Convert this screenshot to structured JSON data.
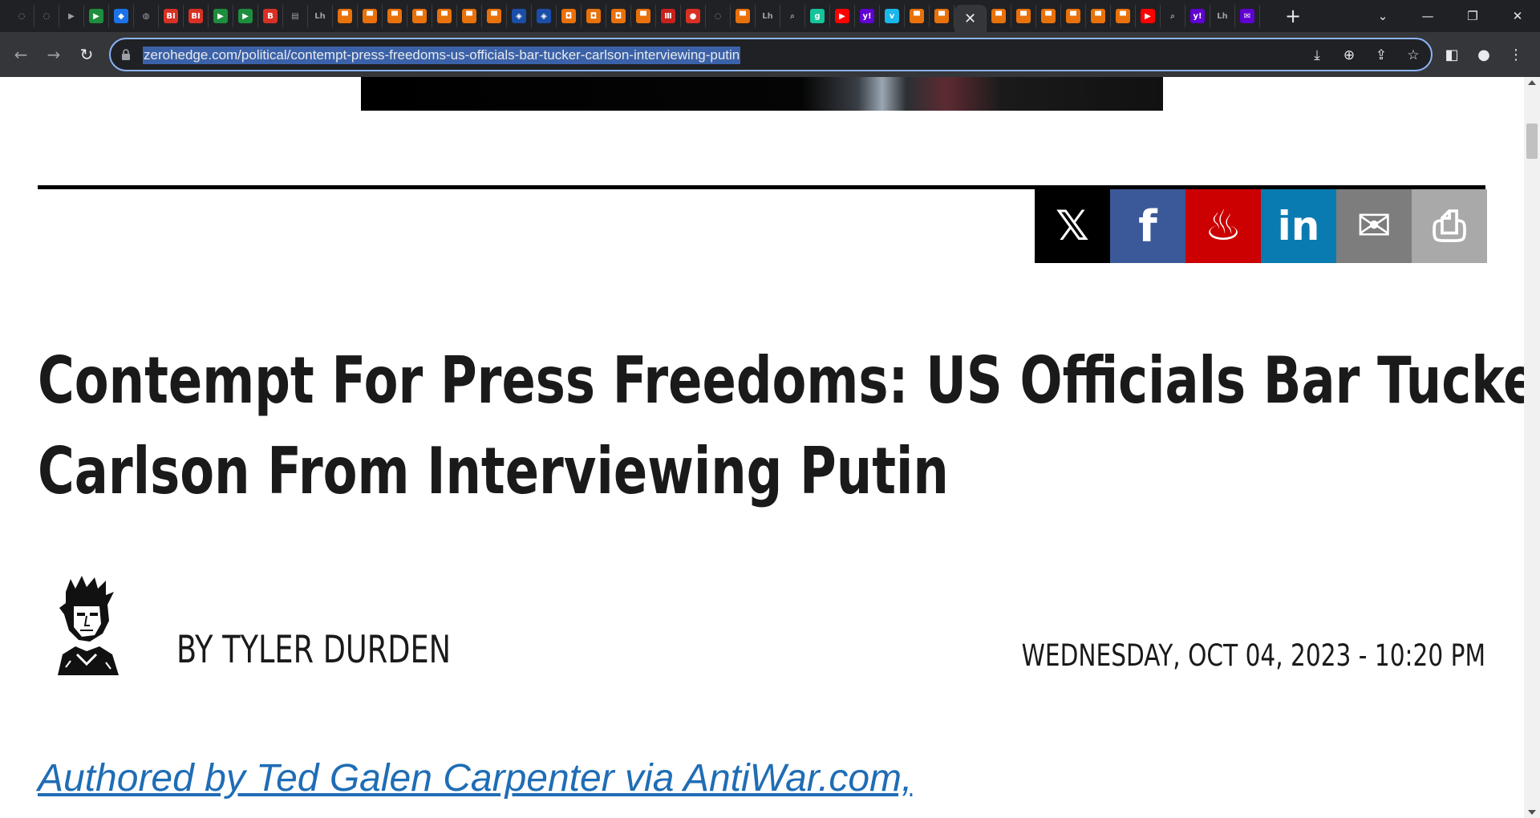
{
  "browser": {
    "tabs": [
      {
        "icon": "shield-icon",
        "color": "#202124",
        "glyph": "◌"
      },
      {
        "icon": "shield-icon",
        "color": "#202124",
        "glyph": "◌"
      },
      {
        "icon": "play-forward-icon",
        "color": "#5f6368",
        "glyph": "▶"
      },
      {
        "icon": "play-green-icon",
        "color": "#1e8e3e",
        "glyph": "▶"
      },
      {
        "icon": "cap-icon",
        "color": "#1a73e8",
        "glyph": "◆"
      },
      {
        "icon": "globe-icon",
        "color": "#5f6368",
        "glyph": "◍"
      },
      {
        "icon": "bi-icon",
        "color": "#d93025",
        "glyph": "BI"
      },
      {
        "icon": "bi-icon",
        "color": "#d93025",
        "glyph": "BI"
      },
      {
        "icon": "play-green-icon",
        "color": "#1e8e3e",
        "glyph": "▶"
      },
      {
        "icon": "play-green-icon",
        "color": "#1e8e3e",
        "glyph": "▶"
      },
      {
        "icon": "bi-icon",
        "color": "#d93025",
        "glyph": "B"
      },
      {
        "icon": "news-icon",
        "color": "#e8eaed",
        "glyph": "▤"
      },
      {
        "icon": "letters-icon",
        "color": "#5f6368",
        "glyph": "Lh"
      },
      {
        "icon": "bookmark-orange-icon",
        "color": "#e8710a",
        "glyph": "▀"
      },
      {
        "icon": "bookmark-orange-icon",
        "color": "#e8710a",
        "glyph": "▀"
      },
      {
        "icon": "bookmark-orange-icon",
        "color": "#e8710a",
        "glyph": "▀"
      },
      {
        "icon": "bookmark-orange-icon",
        "color": "#e8710a",
        "glyph": "▀"
      },
      {
        "icon": "bookmark-orange-icon",
        "color": "#e8710a",
        "glyph": "▀"
      },
      {
        "icon": "bookmark-orange-icon",
        "color": "#e8710a",
        "glyph": "▀"
      },
      {
        "icon": "bookmark-orange-icon",
        "color": "#e8710a",
        "glyph": "▀"
      },
      {
        "icon": "cube-icon",
        "color": "#1a4ea8",
        "glyph": "◈"
      },
      {
        "icon": "cube-icon",
        "color": "#1a4ea8",
        "glyph": "◈"
      },
      {
        "icon": "shield-orange-icon",
        "color": "#e8710a",
        "glyph": "◘"
      },
      {
        "icon": "shield-orange-icon",
        "color": "#e8710a",
        "glyph": "◘"
      },
      {
        "icon": "shield-orange-icon",
        "color": "#e8710a",
        "glyph": "◘"
      },
      {
        "icon": "bookmark-orange-icon",
        "color": "#e8710a",
        "glyph": "▀"
      },
      {
        "icon": "bars-icon",
        "color": "#c5221f",
        "glyph": "Ⅲ"
      },
      {
        "icon": "mic-red-icon",
        "color": "#d93025",
        "glyph": "●"
      },
      {
        "icon": "shield-icon",
        "color": "#202124",
        "glyph": "◌"
      },
      {
        "icon": "bookmark-orange-icon",
        "color": "#e8710a",
        "glyph": "▀"
      },
      {
        "icon": "letters-icon",
        "color": "#5f6368",
        "glyph": "Lh"
      },
      {
        "icon": "search-icon",
        "color": "#202124",
        "glyph": "⌕"
      },
      {
        "icon": "g-green-icon",
        "color": "#15c39a",
        "glyph": "g"
      },
      {
        "icon": "youtube-icon",
        "color": "#ff0000",
        "glyph": "▶"
      },
      {
        "icon": "yahoo-icon",
        "color": "#6001d2",
        "glyph": "y!"
      },
      {
        "icon": "vimeo-icon",
        "color": "#1ab7ea",
        "glyph": "v"
      },
      {
        "icon": "bookmark-orange-icon",
        "color": "#e8710a",
        "glyph": "▀"
      },
      {
        "icon": "bookmark-orange-icon",
        "color": "#e8710a",
        "glyph": "▀"
      }
    ],
    "tabs_after": [
      {
        "icon": "bookmark-orange-icon",
        "color": "#e8710a",
        "glyph": "▀"
      },
      {
        "icon": "bookmark-orange-icon",
        "color": "#e8710a",
        "glyph": "▀"
      },
      {
        "icon": "bookmark-orange-icon",
        "color": "#e8710a",
        "glyph": "▀"
      },
      {
        "icon": "bookmark-orange-icon",
        "color": "#e8710a",
        "glyph": "▀"
      },
      {
        "icon": "bookmark-orange-icon",
        "color": "#e8710a",
        "glyph": "▀"
      },
      {
        "icon": "bookmark-orange-icon",
        "color": "#e8710a",
        "glyph": "▀"
      },
      {
        "icon": "youtube-icon",
        "color": "#ff0000",
        "glyph": "▶"
      },
      {
        "icon": "search-icon",
        "color": "#202124",
        "glyph": "⌕"
      },
      {
        "icon": "yahoo-icon",
        "color": "#6001d2",
        "glyph": "y!"
      },
      {
        "icon": "letters-icon",
        "color": "#5f6368",
        "glyph": "Lh"
      },
      {
        "icon": "yahoo-mail-icon",
        "color": "#6001d2",
        "glyph": "✉"
      }
    ],
    "active_tab_close": "✕",
    "new_tab": "+",
    "url": "zerohedge.com/political/contempt-press-freedoms-us-officials-bar-tucker-carlson-interviewing-putin"
  },
  "page": {
    "share_buttons": [
      {
        "name": "share-x-button",
        "icon": "x-icon",
        "glyph": "𝕏",
        "cls": "sh-x"
      },
      {
        "name": "share-facebook-button",
        "icon": "facebook-icon",
        "glyph": "f",
        "cls": "sh-fb"
      },
      {
        "name": "share-gab-button",
        "icon": "gab-torch-icon",
        "glyph": "♨",
        "cls": "sh-gab"
      },
      {
        "name": "share-linkedin-button",
        "icon": "linkedin-icon",
        "glyph": "in",
        "cls": "sh-in"
      },
      {
        "name": "share-email-button",
        "icon": "mail-icon",
        "glyph": "✉",
        "cls": "sh-mail"
      },
      {
        "name": "share-print-button",
        "icon": "printer-icon",
        "glyph": "⎙",
        "cls": "sh-print"
      }
    ],
    "headline_line1": "Contempt For Press Freedoms: US Officials Bar Tucker",
    "headline_line2": "Carlson From Interviewing Putin",
    "byline": "BY TYLER DURDEN",
    "date": "WEDNESDAY, OCT 04, 2023 - 10:20 PM",
    "author_link": "Authored by Ted Galen Carpenter via AntiWar.com,"
  }
}
